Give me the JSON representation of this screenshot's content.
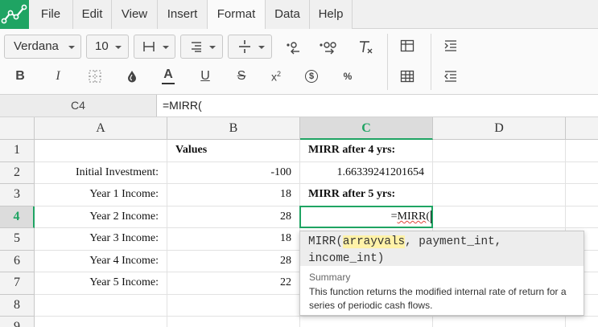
{
  "menu": {
    "tabs": [
      {
        "label": "File"
      },
      {
        "label": "Edit"
      },
      {
        "label": "View"
      },
      {
        "label": "Insert"
      },
      {
        "label": "Format"
      },
      {
        "label": "Data"
      },
      {
        "label": "Help"
      }
    ],
    "active_tab": "Format"
  },
  "toolbar": {
    "font_family": "Verdana",
    "font_size": "10",
    "buttons": {
      "bold": "B",
      "italic": "I",
      "underline": "U",
      "strike": "S",
      "font_color": "A",
      "currency": "$",
      "percent": "%",
      "superscript_base": "x",
      "superscript_exp": "2"
    }
  },
  "formula_bar": {
    "name_box": "C4",
    "formula": "=MIRR("
  },
  "grid": {
    "columns": [
      "A",
      "B",
      "C",
      "D"
    ],
    "selected_column": "C",
    "rows": [
      "1",
      "2",
      "3",
      "4",
      "5",
      "6",
      "7",
      "8",
      "9"
    ],
    "selected_row": "4",
    "cells": {
      "B1": "Values",
      "C1": "MIRR after 4 yrs:",
      "A2": "Initial Investment:",
      "B2": "-100",
      "C2": "1.66339241201654",
      "A3": "Year 1 Income:",
      "B3": "18",
      "C3": "MIRR after 5 yrs:",
      "A4": "Year 2 Income:",
      "B4": "28",
      "C4_prefix": "=",
      "C4_fn": "MIRR",
      "C4_suffix": "(",
      "A5": "Year 3 Income:",
      "B5": "18",
      "A6": "Year 4 Income:",
      "B6": "28",
      "A7": "Year 5 Income:",
      "B7": "22"
    }
  },
  "function_tip": {
    "fn_name": "MIRR(",
    "arg1": "arrayvals",
    "rest_line1": ", payment_int,",
    "line2": "income_int)",
    "summary_label": "Summary",
    "summary_line1": "This function returns the modified internal rate of return for a",
    "summary_line2": "series of periodic cash flows."
  },
  "colors": {
    "accent": "#1fa463",
    "highlight": "#fff2a8"
  }
}
